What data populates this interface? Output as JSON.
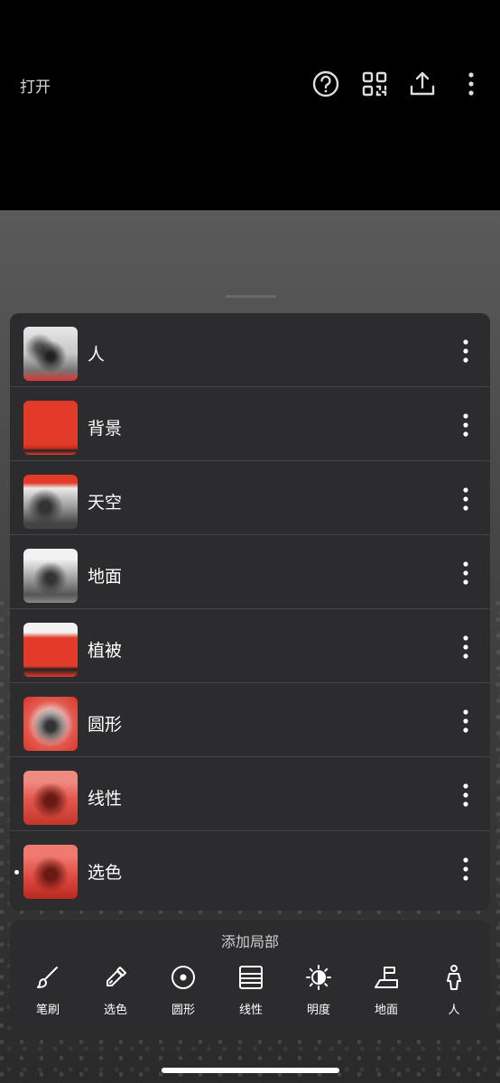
{
  "header": {
    "open_label": "打开",
    "icons": [
      "help-icon",
      "qr-icon",
      "share-icon",
      "more-icon"
    ]
  },
  "masks": {
    "items": [
      {
        "label": "人",
        "thumb": "people"
      },
      {
        "label": "背景",
        "thumb": "background"
      },
      {
        "label": "天空",
        "thumb": "sky"
      },
      {
        "label": "地面",
        "thumb": "ground"
      },
      {
        "label": "植被",
        "thumb": "vegetation"
      },
      {
        "label": "圆形",
        "thumb": "circle"
      },
      {
        "label": "线性",
        "thumb": "linear"
      },
      {
        "label": "选色",
        "thumb": "color-select"
      }
    ],
    "selected_index": 7
  },
  "add_panel": {
    "title": "添加局部",
    "tools": [
      {
        "label": "笔刷",
        "icon": "brush-icon"
      },
      {
        "label": "选色",
        "icon": "eyedropper-icon"
      },
      {
        "label": "圆形",
        "icon": "radial-icon"
      },
      {
        "label": "线性",
        "icon": "linear-icon"
      },
      {
        "label": "明度",
        "icon": "brightness-icon"
      },
      {
        "label": "地面",
        "icon": "ground-icon"
      },
      {
        "label": "人",
        "icon": "person-icon"
      }
    ]
  },
  "colors": {
    "mask_red": "#e23b2a",
    "panel_bg": "#2c2c2e"
  }
}
